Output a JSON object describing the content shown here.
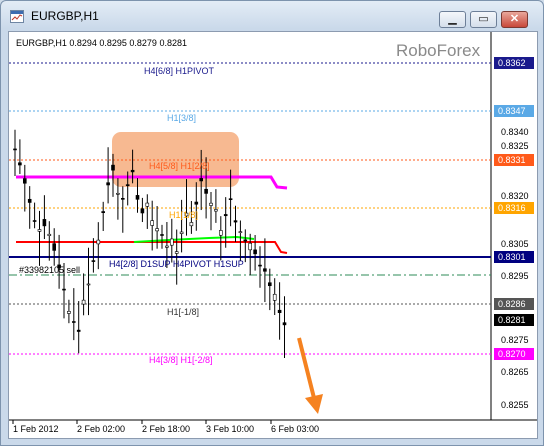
{
  "window": {
    "title": "EURGBP,H1",
    "buttons": {
      "minimize": "▁",
      "maximize": "▭",
      "close": "✕"
    },
    "icon": "chart-window-icon"
  },
  "chart": {
    "header": "EURGBP,H1  0.8294 0.8295 0.8279 0.8281",
    "watermark": "RoboForex",
    "order_label": "#33982105 sell",
    "y_ticks": [
      "0.8340",
      "0.8325",
      "0.8320",
      "0.8305",
      "0.8295",
      "0.8275",
      "0.8265",
      "0.8255"
    ],
    "x_ticks": [
      "1 Feb 2012",
      "2 Feb 02:00",
      "2 Feb 18:00",
      "3 Feb 10:00",
      "6 Feb 03:00"
    ],
    "levels": [
      {
        "text": "H4[6/8] H1PIVOT",
        "price_tag": "0.8362",
        "color": "#1a1a8c",
        "tag_bg": "#1a1a8c",
        "tag_fg": "#ffffff"
      },
      {
        "text": "H1[3/8]",
        "price_tag": "0.8347",
        "color": "#5aa9e6",
        "tag_bg": "#5aa9e6",
        "tag_fg": "#ffffff"
      },
      {
        "text": "H4[5/8] H1[2/8]",
        "price_tag": "0.8331",
        "color": "#ff5a1a",
        "tag_bg": "#ff5a1a",
        "tag_fg": "#ffffff"
      },
      {
        "text": "H1[1/8]",
        "price_tag": "0.8316",
        "color": "#ffa500",
        "tag_bg": "#ffa500",
        "tag_fg": "#ffffff"
      },
      {
        "text": "H4[2/8] D1SUP H4PIVOT H1SUP",
        "price_tag": "0.8301",
        "color": "#000080",
        "tag_bg": "#000080",
        "tag_fg": "#ffffff"
      },
      {
        "text": "",
        "price_tag": "0.8286",
        "color": "#555555",
        "tag_bg": "#555555",
        "tag_fg": "#ffffff"
      },
      {
        "text": "H1[-1/8]",
        "price_tag": "",
        "color": "#333333",
        "tag_bg": "",
        "tag_fg": ""
      },
      {
        "text": "",
        "price_tag": "0.8281",
        "color": "#000000",
        "tag_bg": "#000000",
        "tag_fg": "#ffffff"
      },
      {
        "text": "H4[3/8] H1[-2/8]",
        "price_tag": "0.8270",
        "color": "#ff00ff",
        "tag_bg": "#ff00ff",
        "tag_fg": "#ffffff"
      }
    ],
    "colors": {
      "highlight_box": "#f6ad7e",
      "magenta_line": "#ff00ff",
      "red_line": "#ff0000",
      "green_line": "#00ff00",
      "order_line": "#2e8b57",
      "arrow": "#f58220",
      "candle": "#000000"
    }
  }
}
